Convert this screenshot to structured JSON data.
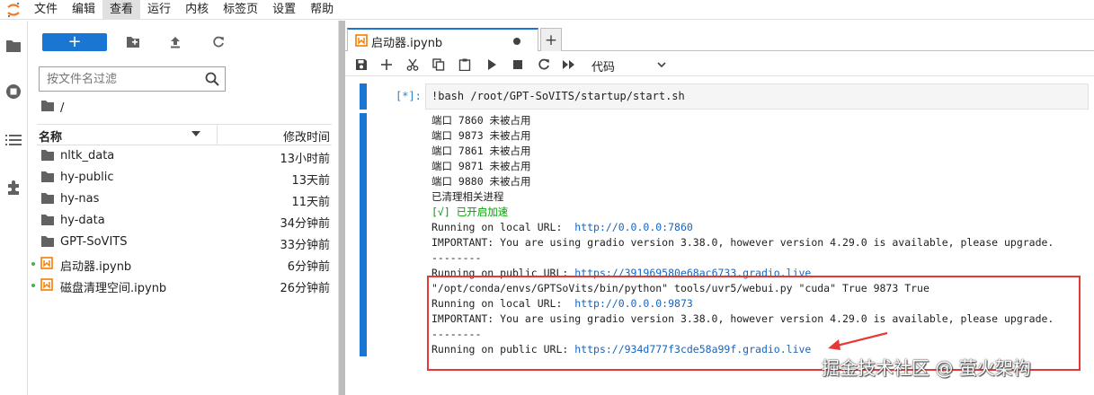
{
  "menubar": {
    "items": [
      "文件",
      "编辑",
      "查看",
      "运行",
      "内核",
      "标签页",
      "设置",
      "帮助"
    ],
    "active_index": 2
  },
  "activitybar": {
    "icons": [
      "folder-icon",
      "running-icon",
      "toc-icon",
      "extension-icon"
    ]
  },
  "filebrowser": {
    "new_launcher_label": "+",
    "filter_placeholder": "按文件名过滤",
    "breadcrumb": "/",
    "columns": {
      "name": "名称",
      "modified": "修改时间"
    },
    "items": [
      {
        "name": "nltk_data",
        "modified": "13小时前",
        "type": "folder",
        "running": false
      },
      {
        "name": "hy-public",
        "modified": "13天前",
        "type": "folder",
        "running": false
      },
      {
        "name": "hy-nas",
        "modified": "11天前",
        "type": "folder",
        "running": false
      },
      {
        "name": "hy-data",
        "modified": "34分钟前",
        "type": "folder",
        "running": false
      },
      {
        "name": "GPT-SoVITS",
        "modified": "33分钟前",
        "type": "folder",
        "running": false
      },
      {
        "name": "启动器.ipynb",
        "modified": "6分钟前",
        "type": "notebook",
        "running": true
      },
      {
        "name": "磁盘清理空间.ipynb",
        "modified": "26分钟前",
        "type": "notebook",
        "running": true
      }
    ]
  },
  "notebook": {
    "tab_label": "启动器.ipynb",
    "add_tab_label": "+",
    "cell_type": "代码",
    "cell": {
      "prompt": "[*]:",
      "input": "!bash /root/GPT-SoVITS/startup/start.sh",
      "output_lines": [
        {
          "text": "端口 7860 未被占用"
        },
        {
          "text": "端口 9873 未被占用"
        },
        {
          "text": "端口 7861 未被占用"
        },
        {
          "text": "端口 9871 未被占用"
        },
        {
          "text": "端口 9880 未被占用"
        },
        {
          "text": "已清理相关进程"
        },
        {
          "text": "[√] 已开启加速",
          "color": "green"
        },
        {
          "text": "Running on local URL:  ",
          "link": "http://0.0.0.0:7860"
        },
        {
          "text": "IMPORTANT: You are using gradio version 3.38.0, however version 4.29.0 is available, please upgrade."
        },
        {
          "text": "--------"
        },
        {
          "text": "Running on public URL: ",
          "link": "https://391969580e68ac6733.gradio.live"
        },
        {
          "text": "\"/opt/conda/envs/GPTSoVits/bin/python\" tools/uvr5/webui.py \"cuda\" True 9873 True"
        },
        {
          "text": "Running on local URL:  ",
          "link": "http://0.0.0.0:9873"
        },
        {
          "text": "IMPORTANT: You are using gradio version 3.38.0, however version 4.29.0 is available, please upgrade."
        },
        {
          "text": "--------"
        },
        {
          "text": "Running on public URL: ",
          "link": "https://934d777f3cde58a99f.gradio.live"
        }
      ]
    }
  },
  "watermark": "掘金技术社区 @ 萤火架构",
  "colors": {
    "accent": "#1976d2",
    "highlight": "#e53935",
    "notebook_icon": "#f57c00",
    "green_text": "#00a000"
  }
}
